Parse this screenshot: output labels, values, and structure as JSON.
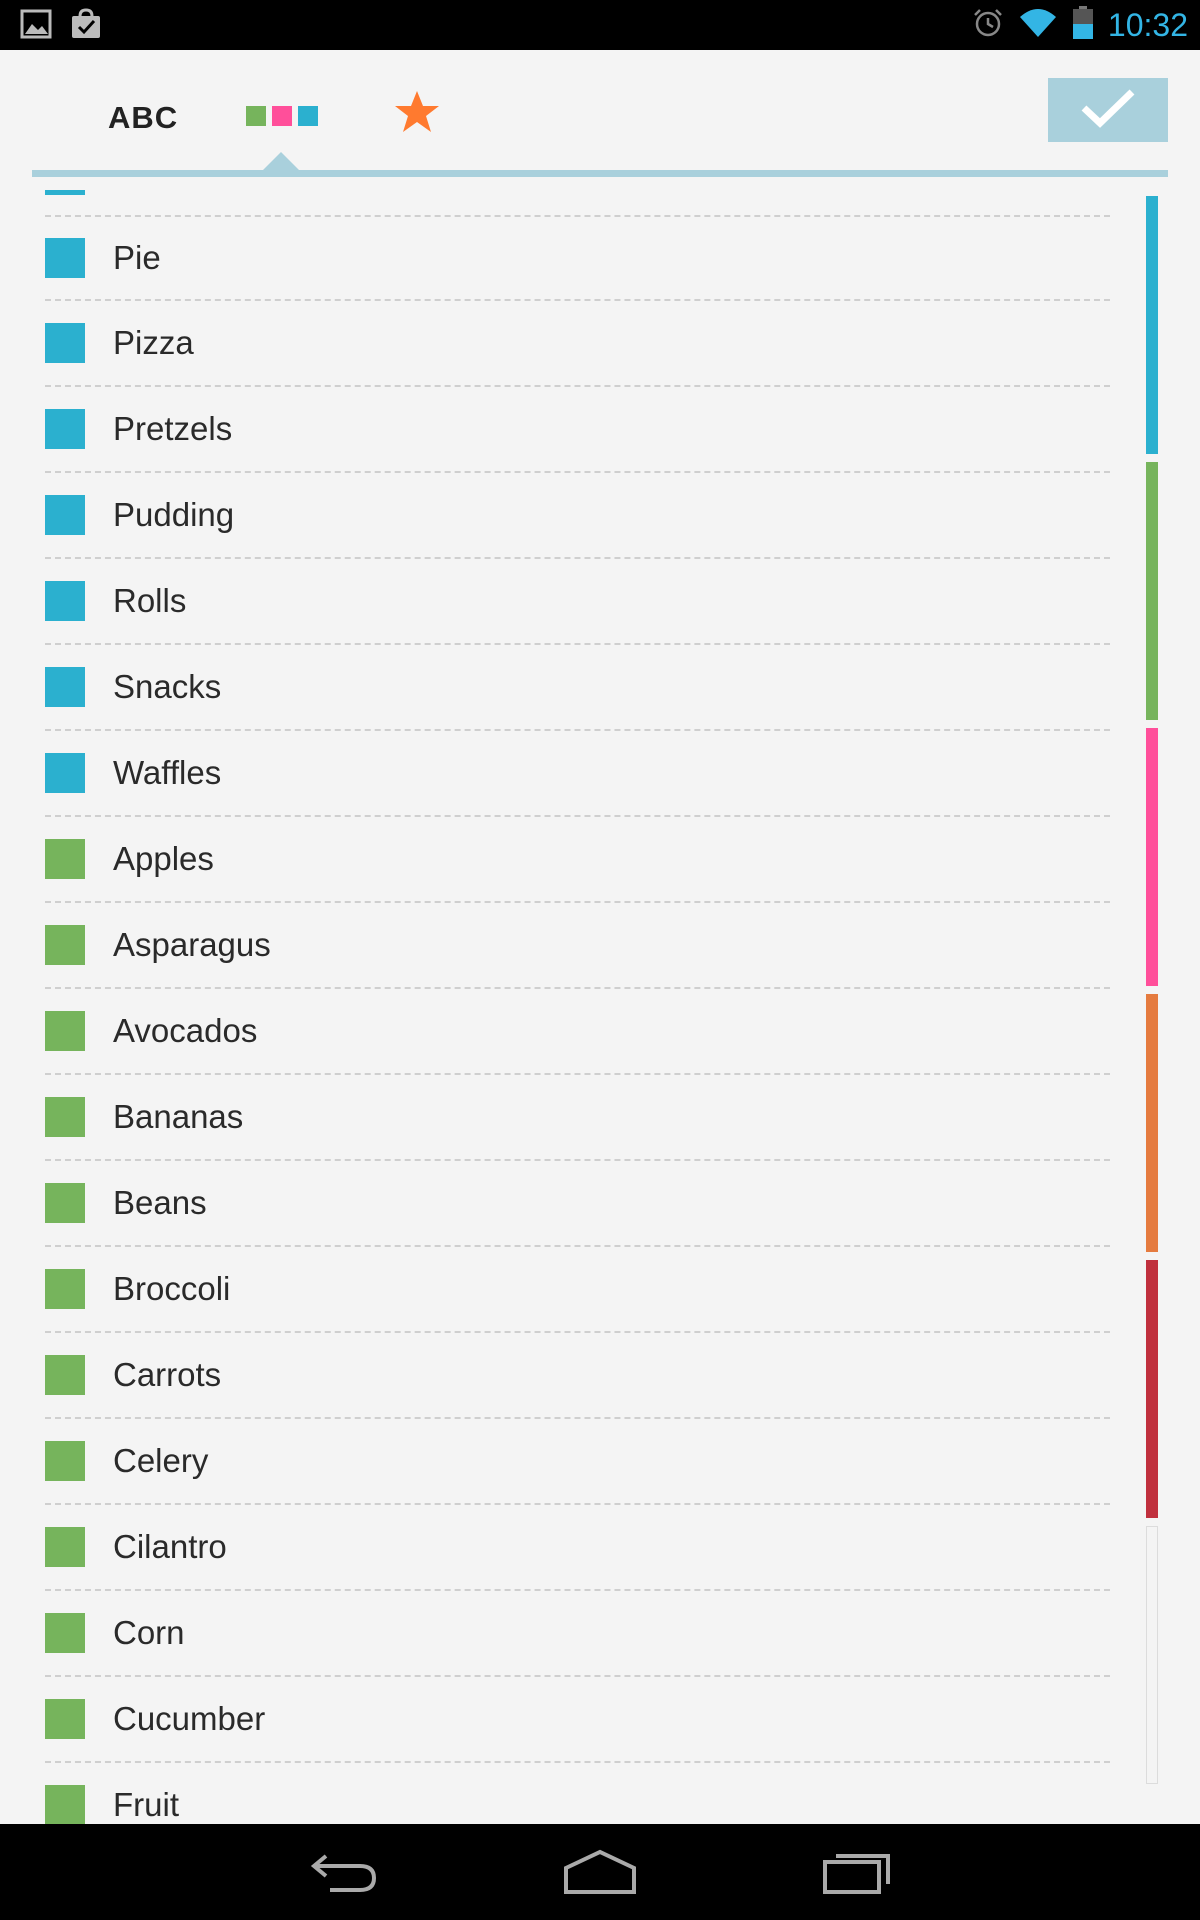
{
  "status_bar": {
    "time": "10:32",
    "left_icons": [
      "gallery-icon",
      "shopping-bag-check-icon"
    ],
    "right_icons": [
      "alarm-icon",
      "wifi-icon",
      "battery-icon"
    ]
  },
  "toolbar": {
    "tab_abc_label": "ABC",
    "tab_colors_icon": "color-squares-icon",
    "tab_favorites_icon": "star-icon",
    "done_icon": "checkmark-icon",
    "colors": {
      "green": "#76b45c",
      "pink": "#ff4f9a",
      "blue": "#2bb0cf",
      "star": "#ff7a2f",
      "accent": "#a9d0dc"
    }
  },
  "list": {
    "items": [
      {
        "label": "Pie",
        "color": "#2bb0cf"
      },
      {
        "label": "Pizza",
        "color": "#2bb0cf"
      },
      {
        "label": "Pretzels",
        "color": "#2bb0cf"
      },
      {
        "label": "Pudding",
        "color": "#2bb0cf"
      },
      {
        "label": "Rolls",
        "color": "#2bb0cf"
      },
      {
        "label": "Snacks",
        "color": "#2bb0cf"
      },
      {
        "label": "Waffles",
        "color": "#2bb0cf"
      },
      {
        "label": "Apples",
        "color": "#76b45c"
      },
      {
        "label": "Asparagus",
        "color": "#76b45c"
      },
      {
        "label": "Avocados",
        "color": "#76b45c"
      },
      {
        "label": "Bananas",
        "color": "#76b45c"
      },
      {
        "label": "Beans",
        "color": "#76b45c"
      },
      {
        "label": "Broccoli",
        "color": "#76b45c"
      },
      {
        "label": "Carrots",
        "color": "#76b45c"
      },
      {
        "label": "Celery",
        "color": "#76b45c"
      },
      {
        "label": "Cilantro",
        "color": "#76b45c"
      },
      {
        "label": "Corn",
        "color": "#76b45c"
      },
      {
        "label": "Cucumber",
        "color": "#76b45c"
      },
      {
        "label": "Fruit",
        "color": "#76b45c"
      }
    ]
  },
  "scroll_index": {
    "segments": [
      {
        "color": "#2bb0cf",
        "filled": true
      },
      {
        "color": "#76b45c",
        "filled": true
      },
      {
        "color": "#ff4f9a",
        "filled": true
      },
      {
        "color": "#e57b3f",
        "filled": true
      },
      {
        "color": "#c0303d",
        "filled": true
      },
      {
        "color": "#dcdcdc",
        "filled": false
      }
    ]
  },
  "nav_bar": {
    "buttons": [
      "back-icon",
      "home-icon",
      "recent-apps-icon"
    ]
  }
}
